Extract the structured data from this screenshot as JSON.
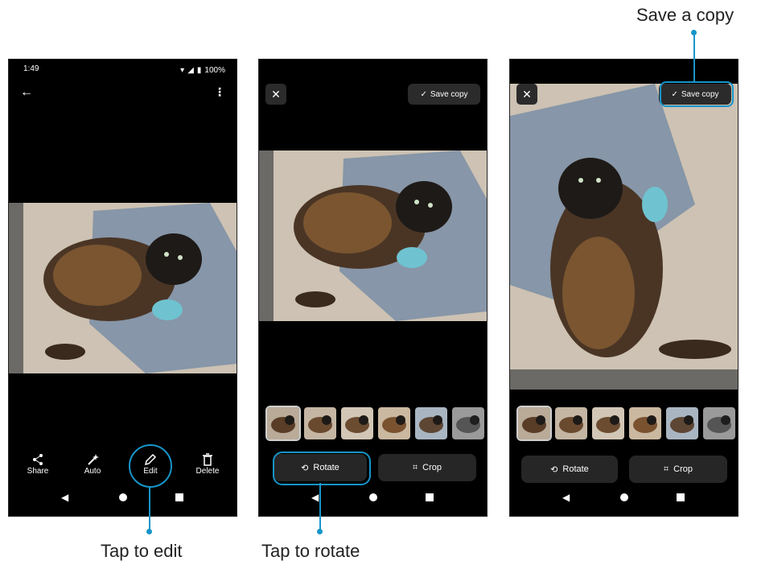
{
  "phone1": {
    "status": {
      "time": "1:49",
      "battery": "100%"
    },
    "actions": [
      {
        "label": "Share",
        "icon": "share-icon"
      },
      {
        "label": "Auto",
        "icon": "magic-wand-icon"
      },
      {
        "label": "Edit",
        "icon": "pencil-icon"
      },
      {
        "label": "Delete",
        "icon": "trash-icon"
      }
    ]
  },
  "phone2": {
    "save_label": "Save copy",
    "rotate_label": "Rotate",
    "crop_label": "Crop"
  },
  "phone3": {
    "save_label": "Save copy",
    "rotate_label": "Rotate",
    "crop_label": "Crop"
  },
  "captions": {
    "edit": "Tap to edit",
    "rotate": "Tap to rotate",
    "save": "Save a copy"
  },
  "colors": {
    "accent": "#1795c9",
    "screen": "#000000",
    "button": "#262626"
  }
}
